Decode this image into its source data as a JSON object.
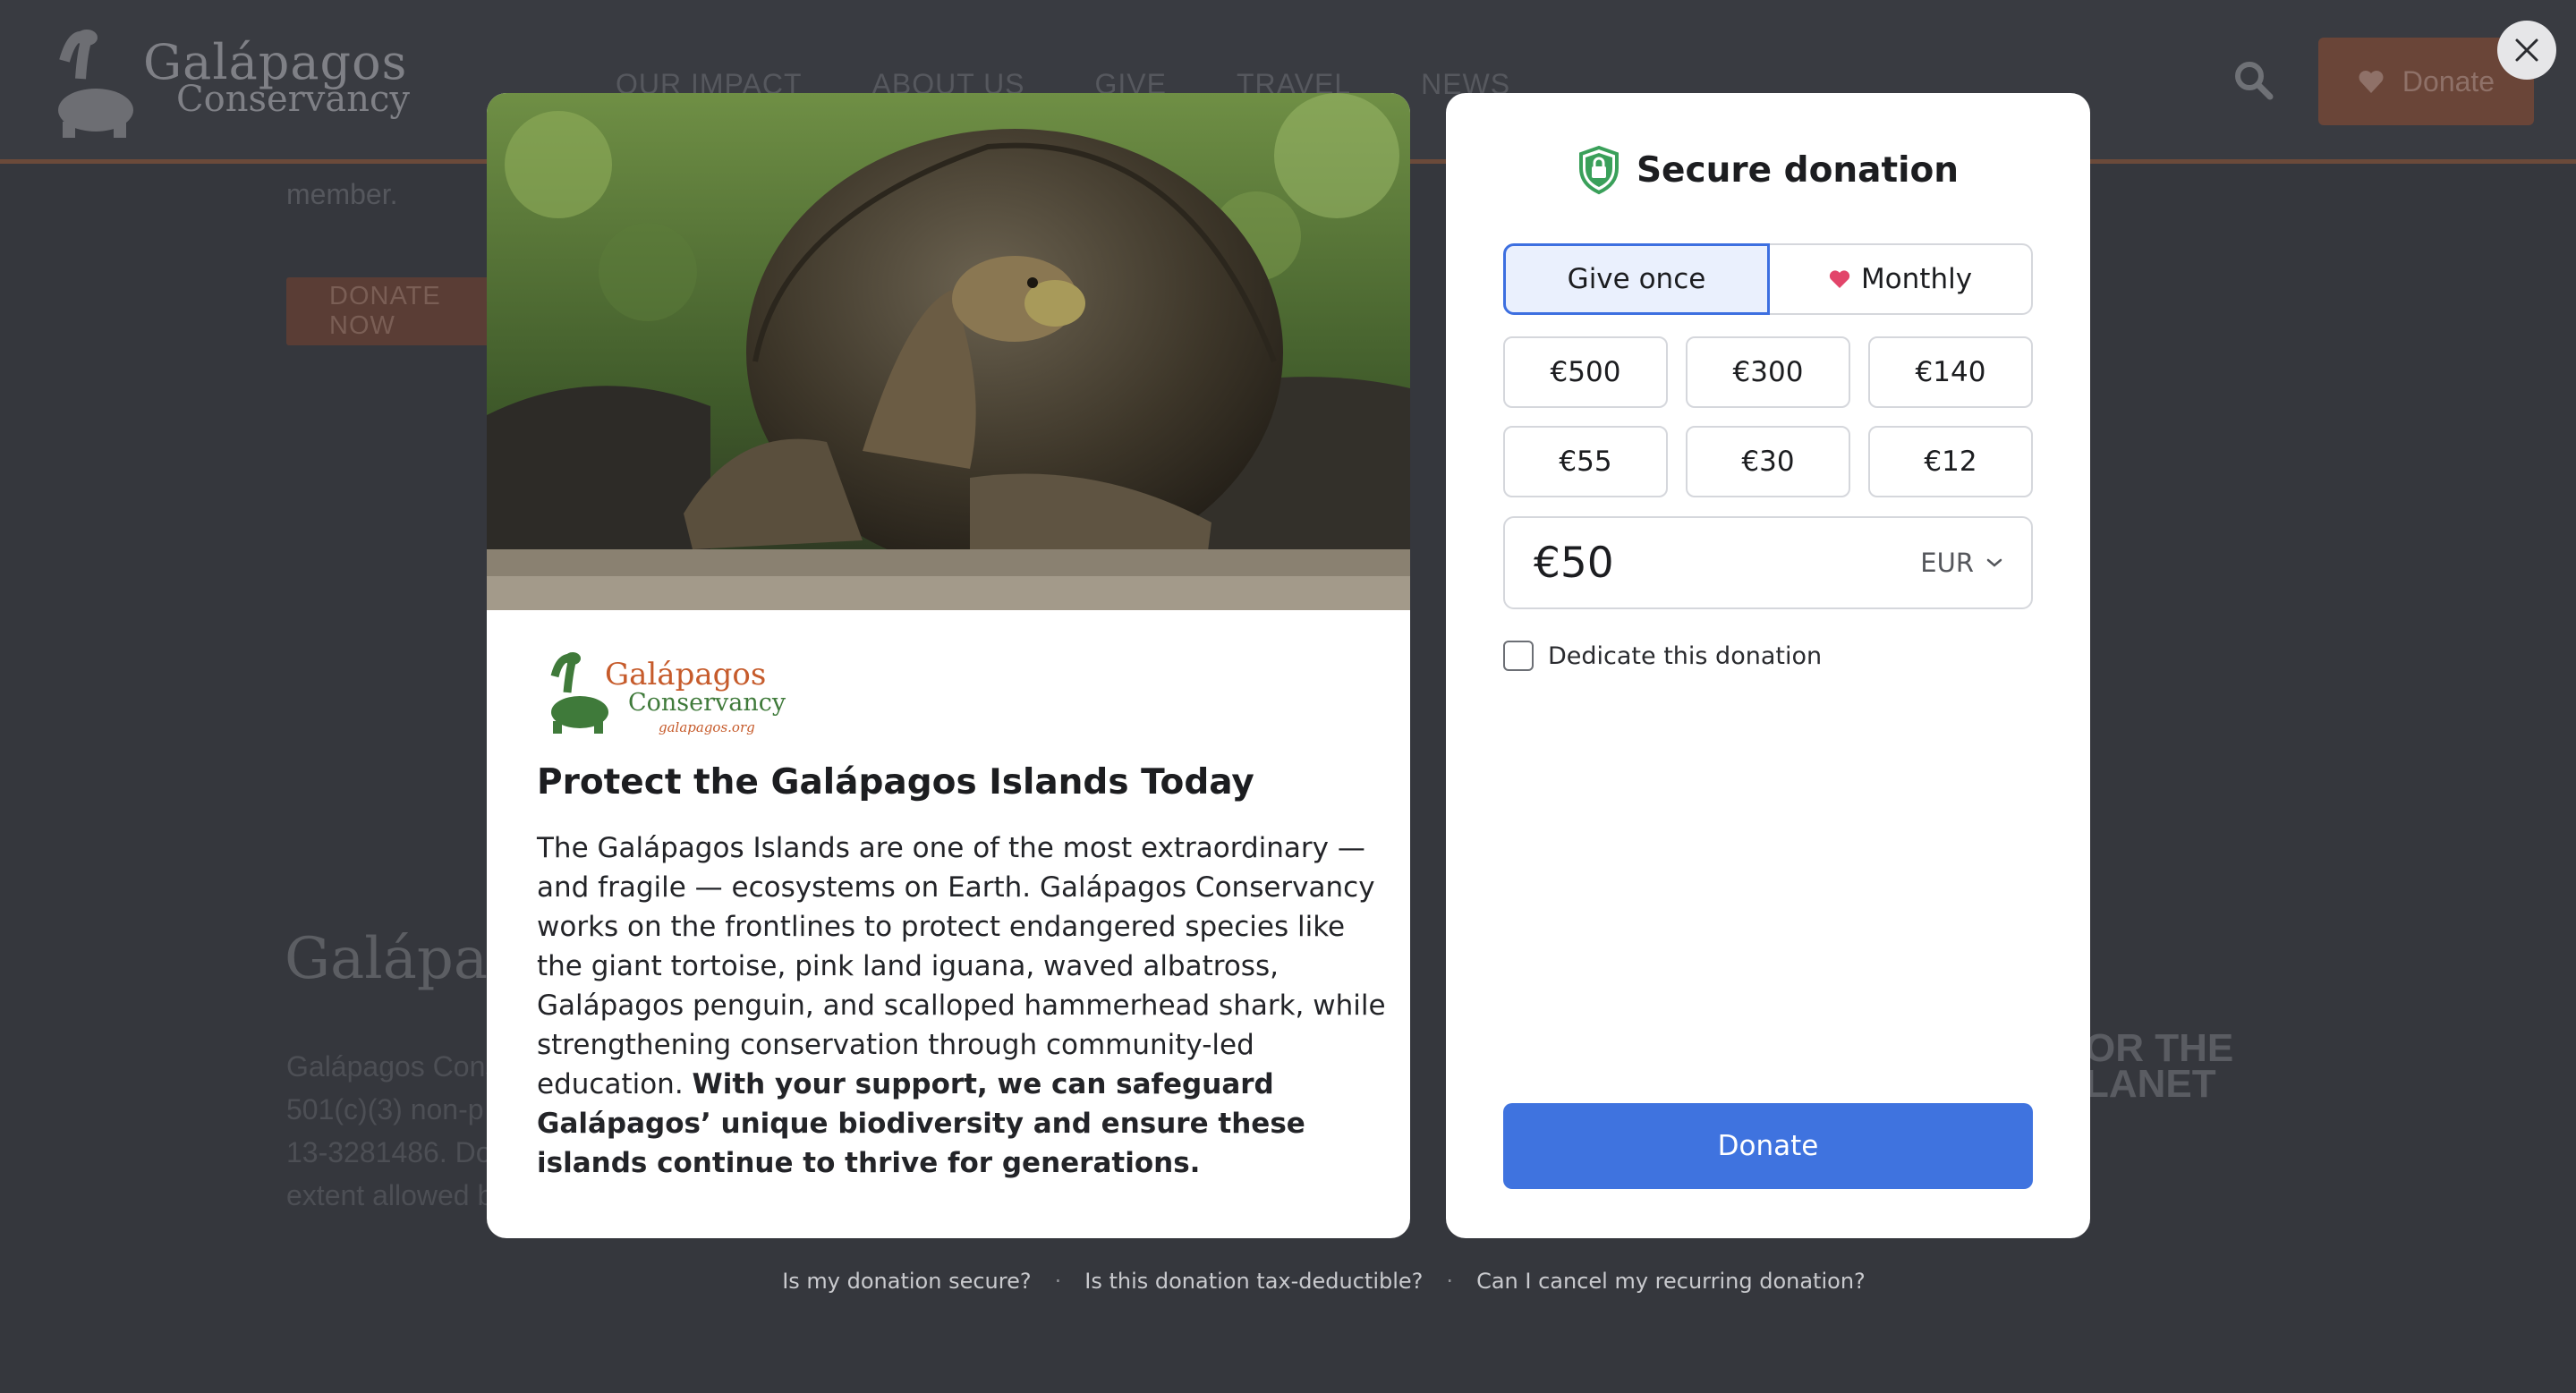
{
  "background": {
    "logo_line1": "Galápagos",
    "logo_line2": "Conservancy",
    "nav": [
      "OUR IMPACT",
      "ABOUT US",
      "GIVE",
      "TRAVEL",
      "NEWS"
    ],
    "header_donate_label": "Donate",
    "member_text": "member.",
    "donate_now_label": "DONATE NOW",
    "footer_heading": "Galápagos",
    "footer_lines": [
      "Galápagos Cons",
      "501(c)(3) non-p",
      "13-3281486. Do",
      "extent allowed b"
    ],
    "partner_logo": [
      "OR THE",
      "LANET"
    ]
  },
  "close_label": "Close",
  "campaign": {
    "logo_line1": "Galápagos",
    "logo_line2": "Conservancy",
    "logo_url_text": "galapagos.org",
    "title": "Protect the Galápagos Islands Today",
    "body_regular": "The Galápagos Islands are one of the most extraordinary — and fragile — ecosystems on Earth. Galápagos Conservancy works on the frontlines to protect endangered species like the giant tortoise, pink land iguana, waved albatross, Galápagos penguin, and scalloped hammerhead shark, while strengthening conservation through community-led education. ",
    "body_bold": "With your support, we can safeguard Galápagos’ unique biodiversity and ensure these islands continue to thrive for generations."
  },
  "donation": {
    "heading": "Secure donation",
    "frequency": {
      "once_label": "Give once",
      "monthly_label": "Monthly",
      "selected": "once"
    },
    "amounts": [
      "€500",
      "€300",
      "€140",
      "€55",
      "€30",
      "€12"
    ],
    "amount_value": "€50",
    "currency": "EUR",
    "dedicate_label": "Dedicate this donation",
    "dedicate_checked": false,
    "donate_label": "Donate",
    "colors": {
      "accent": "#3f73df",
      "selected_bg": "#eaf0fd",
      "heart": "#e2456a",
      "shield": "#3aa05a"
    }
  },
  "faq": [
    "Is my donation secure?",
    "Is this donation tax-deductible?",
    "Can I cancel my recurring donation?"
  ]
}
